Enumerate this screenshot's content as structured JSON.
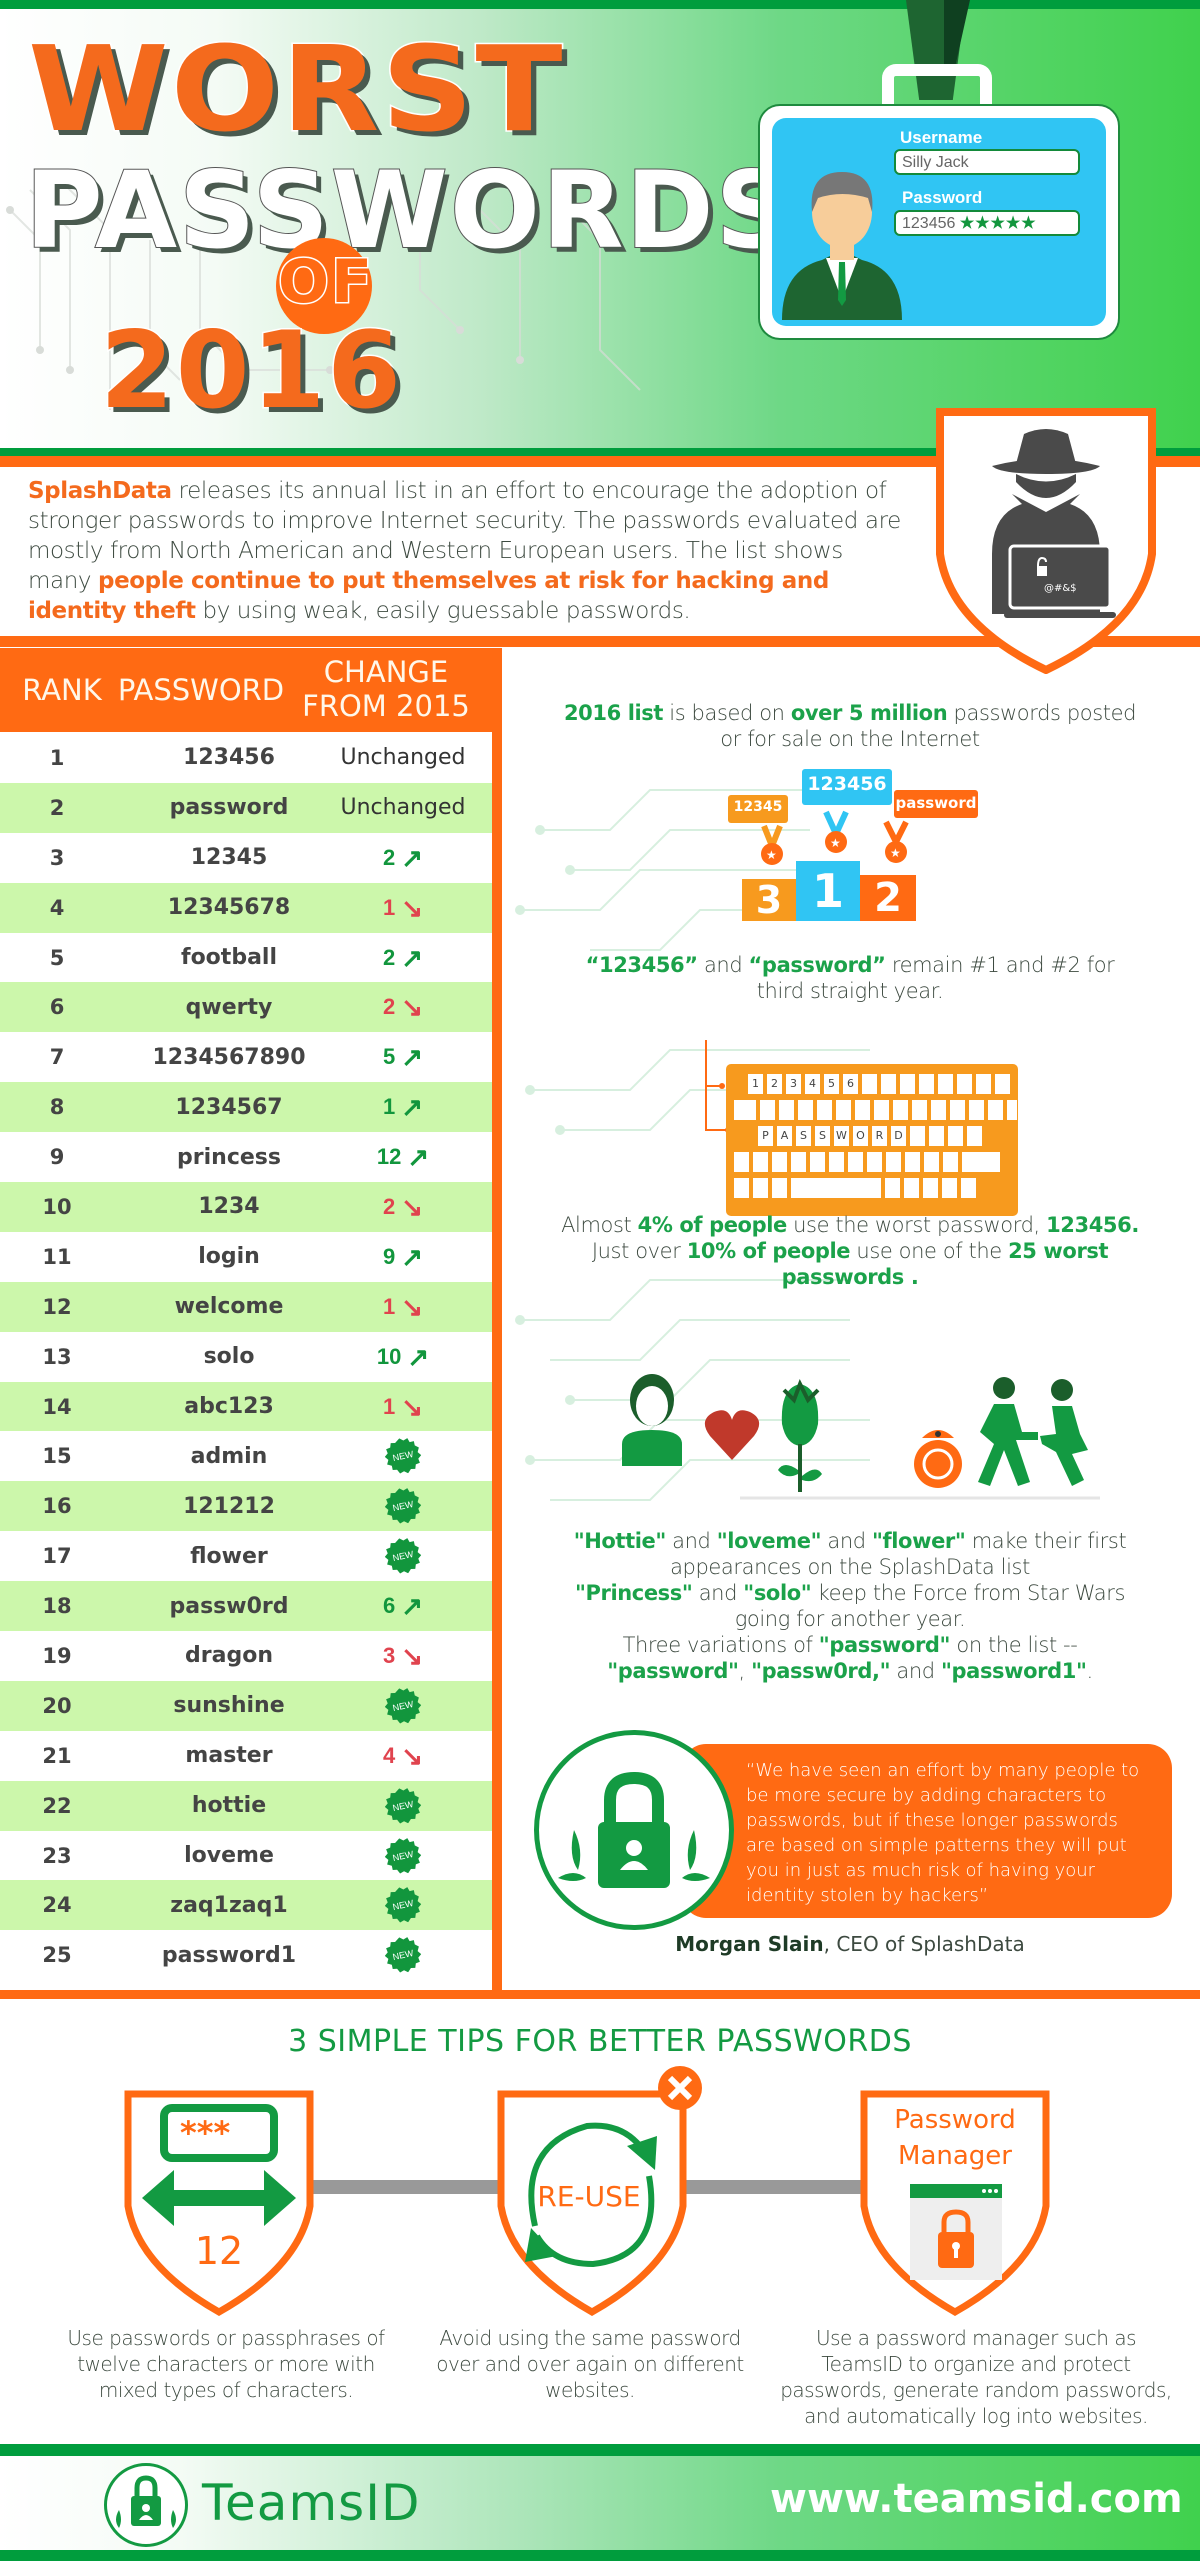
{
  "header": {
    "title_line1": "WORST",
    "title_line2": "PASSWORDS",
    "title_of": "OF",
    "title_year": "2016",
    "badge": {
      "username_label": "Username",
      "username_value": "Silly Jack",
      "password_label": "Password",
      "password_value": "123456",
      "password_mask": "★★★★★"
    }
  },
  "intro": {
    "brand": "SplashData",
    "text1": " releases its annual list in an effort to encourage the adoption of stronger passwords to improve Internet security. The passwords evaluated are mostly from North American and Western European users. The list shows many ",
    "highlight": "people continue to put themselves at risk for hacking and identity theft",
    "text2": " by using weak, easily guessable passwords.",
    "laptop_text": "@#&$"
  },
  "table": {
    "headers": {
      "rank": "RANK",
      "password": "PASSWORD",
      "change_line1": "CHANGE",
      "change_line2": "FROM 2015"
    },
    "new_label": "NEW",
    "rows": [
      {
        "rank": "1",
        "password": "123456",
        "change": "Unchanged",
        "direction": "same"
      },
      {
        "rank": "2",
        "password": "password",
        "change": "Unchanged",
        "direction": "same"
      },
      {
        "rank": "3",
        "password": "12345",
        "change": "2",
        "direction": "up"
      },
      {
        "rank": "4",
        "password": "12345678",
        "change": "1",
        "direction": "down"
      },
      {
        "rank": "5",
        "password": "football",
        "change": "2",
        "direction": "up"
      },
      {
        "rank": "6",
        "password": "qwerty",
        "change": "2",
        "direction": "down"
      },
      {
        "rank": "7",
        "password": "1234567890",
        "change": "5",
        "direction": "up"
      },
      {
        "rank": "8",
        "password": "1234567",
        "change": "1",
        "direction": "up"
      },
      {
        "rank": "9",
        "password": "princess",
        "change": "12",
        "direction": "up"
      },
      {
        "rank": "10",
        "password": "1234",
        "change": "2",
        "direction": "down"
      },
      {
        "rank": "11",
        "password": "login",
        "change": "9",
        "direction": "up"
      },
      {
        "rank": "12",
        "password": "welcome",
        "change": "1",
        "direction": "down"
      },
      {
        "rank": "13",
        "password": "solo",
        "change": "10",
        "direction": "up"
      },
      {
        "rank": "14",
        "password": "abc123",
        "change": "1",
        "direction": "down"
      },
      {
        "rank": "15",
        "password": "admin",
        "change": "NEW",
        "direction": "new"
      },
      {
        "rank": "16",
        "password": "121212",
        "change": "NEW",
        "direction": "new"
      },
      {
        "rank": "17",
        "password": "flower",
        "change": "NEW",
        "direction": "new"
      },
      {
        "rank": "18",
        "password": "passw0rd",
        "change": "6",
        "direction": "up"
      },
      {
        "rank": "19",
        "password": "dragon",
        "change": "3",
        "direction": "down"
      },
      {
        "rank": "20",
        "password": "sunshine",
        "change": "NEW",
        "direction": "new"
      },
      {
        "rank": "21",
        "password": "master",
        "change": "4",
        "direction": "down"
      },
      {
        "rank": "22",
        "password": "hottie",
        "change": "NEW",
        "direction": "new"
      },
      {
        "rank": "23",
        "password": "loveme",
        "change": "NEW",
        "direction": "new"
      },
      {
        "rank": "24",
        "password": "zaq1zaq1",
        "change": "NEW",
        "direction": "new"
      },
      {
        "rank": "25",
        "password": "password1",
        "change": "NEW",
        "direction": "new"
      }
    ]
  },
  "facts": {
    "f1": {
      "b1": "2016 list",
      "t1": " is based on ",
      "b2": "over 5 million",
      "t2": " passwords posted or for sale on the Internet"
    },
    "podium": {
      "first": {
        "place": "1",
        "label": "123456"
      },
      "second": {
        "place": "2",
        "label": "password"
      },
      "third": {
        "place": "3",
        "label": "12345"
      }
    },
    "f2": {
      "b1": "“123456”",
      "t1": " and ",
      "b2": "“password”",
      "t2": " remain #1 and #2 for third straight year."
    },
    "keyboard": {
      "row1": [
        "1",
        "2",
        "3",
        "4",
        "5",
        "6"
      ],
      "row3": [
        "P",
        "A",
        "S",
        "S",
        "W",
        "O",
        "R",
        "D"
      ]
    },
    "f3": {
      "t1": "Almost ",
      "b1": "4% of people",
      "t2": " use the worst password, ",
      "b2": "123456.",
      "t3": "Just over ",
      "b3": "10% of people",
      "t4": " use one of the ",
      "b4": "25 worst passwords ."
    },
    "f4": {
      "b1": "\"Hottie\"",
      "t1": " and ",
      "b2": "\"loveme\"",
      "t2": " and ",
      "b3": "\"flower\"",
      "t3": " make their first appearances on the SplashData list",
      "b4": "\"Princess\"",
      "t4": " and ",
      "b5": "\"solo\"",
      "t5": " keep the Force from Star Wars going for another year.",
      "t6": "Three variations of ",
      "b6": "\"password\"",
      "t7": " on the list -- ",
      "b7": "\"password\"",
      "t8": ", ",
      "b8": "\"passw0rd,\"",
      "t9": " and ",
      "b9": "\"password1\"",
      "t10": "."
    }
  },
  "quote": {
    "text": "“We have seen an effort by many people to be more secure by adding characters to passwords, but if these longer passwords are based on simple patterns they will put you in just as much risk of having your identity stolen by hackers”",
    "author": "Morgan Slain",
    "author_title": ", CEO of SplashData"
  },
  "tips": {
    "title": "3 SIMPLE TIPS FOR BETTER PASSWORDS",
    "items": [
      {
        "icon_text": "12",
        "mask": "***",
        "text": "Use passwords or passphrases of twelve characters or more with mixed types of characters."
      },
      {
        "icon_text": "RE-USE",
        "text": "Avoid using the same password over and over again on different websites."
      },
      {
        "icon_text_1": "Password",
        "icon_text_2": "Manager",
        "text": "Use a password manager such as TeamsID to organize and protect passwords, generate random passwords, and automatically log into websites."
      }
    ]
  },
  "footer": {
    "brand": "TeamsID",
    "url": "www.teamsid.com"
  },
  "colors": {
    "orange": "#ff6a13",
    "green": "#139a42",
    "light_green_row": "#ccf7ab",
    "blue": "#30c5f3",
    "down_red": "#e0434e"
  }
}
